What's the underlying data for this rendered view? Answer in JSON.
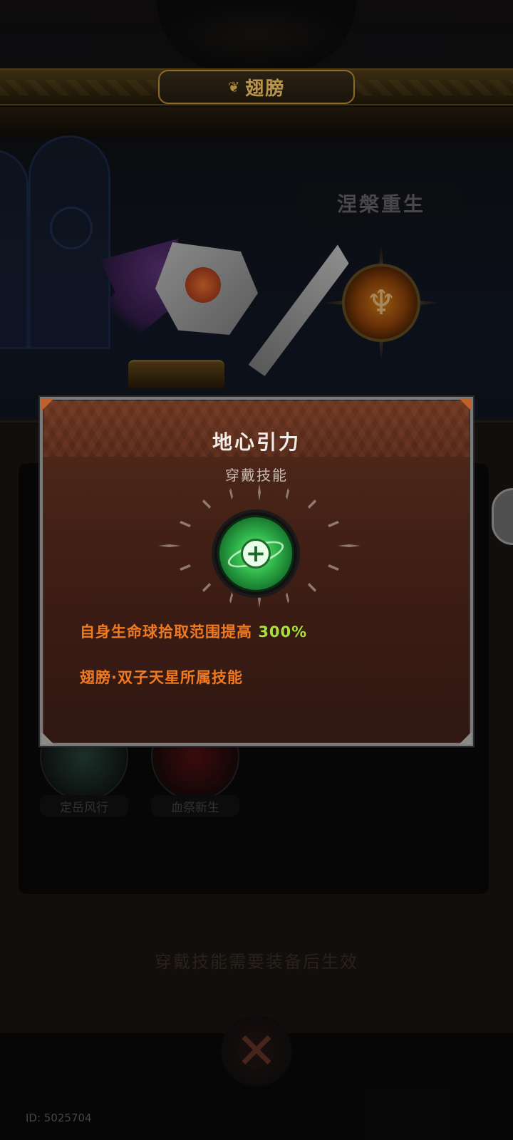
{
  "header": {
    "title": "翅膀"
  },
  "background": {
    "active_skill_label": "涅槃重生",
    "skills": [
      {
        "name": "定岳风行"
      },
      {
        "name": "血祭新生"
      }
    ],
    "hint": "穿戴技能需要装备后生效",
    "player_id": "ID: 5025704"
  },
  "popup": {
    "title": "地心引力",
    "subtitle": "穿戴技能",
    "icon": "green-plus-orb-icon",
    "desc1_text": "自身生命球拾取范围提高",
    "desc1_value": "300%",
    "desc2": "翅膀·双子天星所属技能"
  },
  "colors": {
    "desc_text": "#f07a22",
    "desc_highlight": "#a6e23a",
    "title_gold": "#b9944a"
  }
}
